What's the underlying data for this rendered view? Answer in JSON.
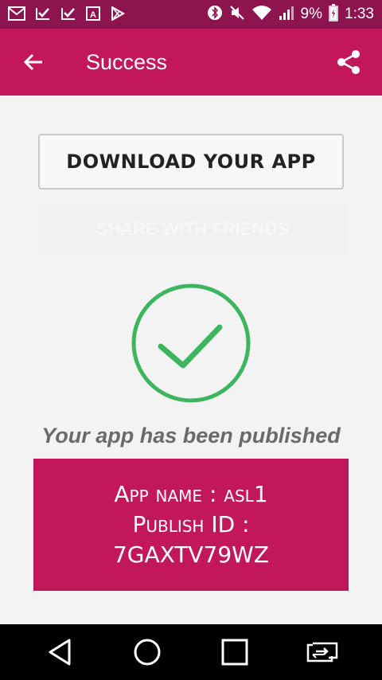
{
  "status_bar": {
    "battery_text": "9%",
    "time": "1:33",
    "icons": [
      "gmail-icon",
      "check-icon",
      "check-icon",
      "accessibility-icon",
      "play-store-icon",
      "bluetooth-icon",
      "mute-icon",
      "wifi-icon",
      "signal-icon",
      "battery-icon"
    ]
  },
  "app_bar": {
    "title": "Success",
    "back_icon": "arrow-back-icon",
    "share_icon": "share-icon",
    "color": "#c2185b"
  },
  "main": {
    "download_label": "DOWNLOAD YOUR APP",
    "faded_label": "SHARE WITH FRIENDS",
    "published_message": "Your app has been published",
    "info": {
      "app_name_line": "App name : asl1",
      "publish_id_label": "Publish ID :",
      "publish_id_value": "7GAXTV79WZ"
    },
    "success_color": "#3cb55e"
  },
  "nav_bar": {
    "buttons": [
      "back-triangle-icon",
      "home-circle-icon",
      "recents-square-icon",
      "switch-app-icon"
    ]
  }
}
